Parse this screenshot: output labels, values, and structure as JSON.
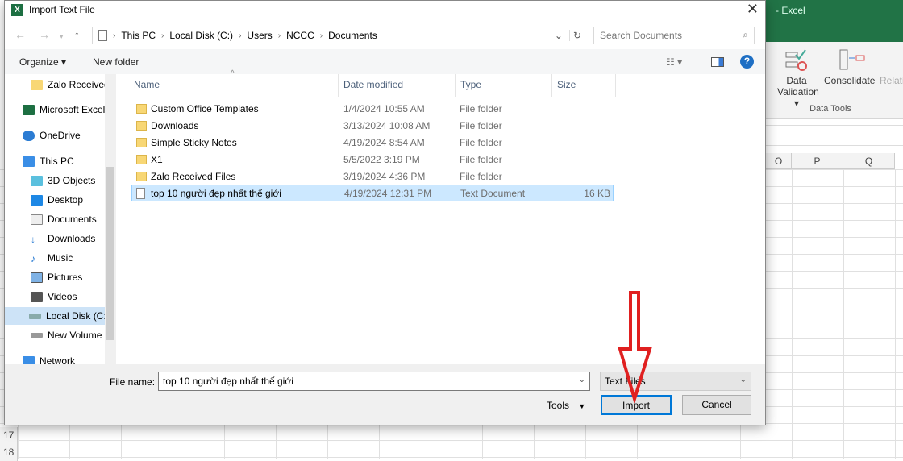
{
  "excel": {
    "title": "- Excel",
    "ribbon": {
      "data_validation_line1": "Data",
      "data_validation_line2": "Validation",
      "consolidate": "Consolidate",
      "relationships": "Relati",
      "group": "Data Tools"
    },
    "columns": [
      "O",
      "P",
      "Q"
    ],
    "rows": [
      "17",
      "18"
    ]
  },
  "dialog": {
    "title": "Import Text File",
    "breadcrumb": [
      "This PC",
      "Local Disk (C:)",
      "Users",
      "NCCC",
      "Documents"
    ],
    "search_placeholder": "Search Documents",
    "toolbar": {
      "organize": "Organize",
      "new_folder": "New folder"
    },
    "sidebar": [
      {
        "label": "Zalo Received Files",
        "icon": "folder"
      },
      {
        "label": "Microsoft Excel",
        "icon": "excel"
      },
      {
        "label": "OneDrive",
        "icon": "cloud"
      },
      {
        "label": "This PC",
        "icon": "pc"
      },
      {
        "label": "3D Objects",
        "icon": "cube"
      },
      {
        "label": "Desktop",
        "icon": "desktop"
      },
      {
        "label": "Documents",
        "icon": "documents"
      },
      {
        "label": "Downloads",
        "icon": "download"
      },
      {
        "label": "Music",
        "icon": "music"
      },
      {
        "label": "Pictures",
        "icon": "pictures"
      },
      {
        "label": "Videos",
        "icon": "videos"
      },
      {
        "label": "Local Disk (C:)",
        "icon": "drive",
        "selected": true
      },
      {
        "label": "New Volume (D:)",
        "icon": "drive"
      },
      {
        "label": "Network",
        "icon": "network"
      }
    ],
    "columns": {
      "name": "Name",
      "date": "Date modified",
      "type": "Type",
      "size": "Size"
    },
    "files": [
      {
        "name": "Custom Office Templates",
        "date": "1/4/2024 10:55 AM",
        "type": "File folder",
        "size": ""
      },
      {
        "name": "Downloads",
        "date": "3/13/2024 10:08 AM",
        "type": "File folder",
        "size": ""
      },
      {
        "name": "Simple Sticky Notes",
        "date": "4/19/2024 8:54 AM",
        "type": "File folder",
        "size": ""
      },
      {
        "name": "X1",
        "date": "5/5/2022 3:19 PM",
        "type": "File folder",
        "size": ""
      },
      {
        "name": "Zalo Received Files",
        "date": "3/19/2024 4:36 PM",
        "type": "File folder",
        "size": ""
      },
      {
        "name": "top 10 người đẹp nhất thế giới",
        "date": "4/19/2024 12:31 PM",
        "type": "Text Document",
        "size": "16 KB",
        "selected": true
      }
    ],
    "file_name_label": "File name:",
    "file_name_value": "top 10 người đẹp nhất thế giới",
    "file_type": "Text Files",
    "tools": "Tools",
    "import": "Import",
    "cancel": "Cancel"
  },
  "colors": {
    "excel_green": "#217346",
    "selection": "#cce8ff",
    "annotation_arrow": "#e02020"
  }
}
